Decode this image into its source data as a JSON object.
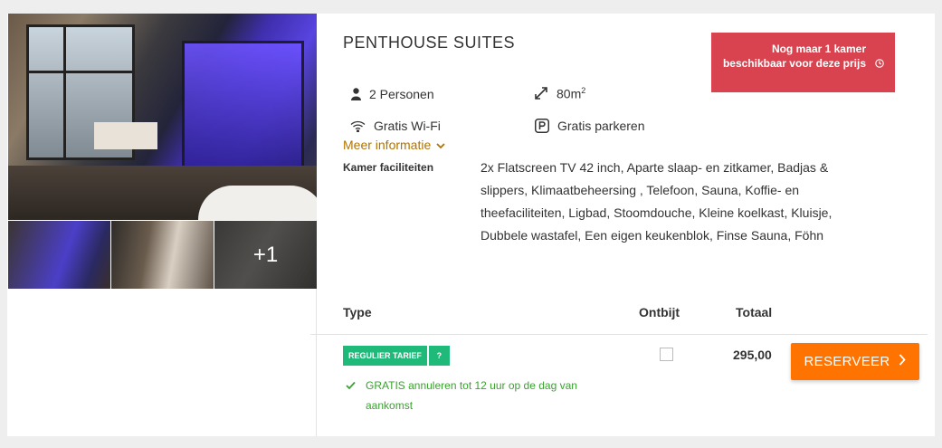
{
  "room": {
    "title": "PENTHOUSE SUITES",
    "photos_more": "+1",
    "features": {
      "persons": "2 Personen",
      "size": "80m",
      "size_sup": "2",
      "wifi": "Gratis Wi-Fi",
      "parking": "Gratis parkeren"
    },
    "more_info": "Meer informatie",
    "facilities_label": "Kamer faciliteiten",
    "facilities_text": "2x Flatscreen TV 42 inch, Aparte slaap- en zitkamer, Badjas & slippers, Klimaatbeheersing , Telefoon, Sauna, Koffie- en theefaciliteiten, Ligbad, Stoomdouche, Kleine koelkast, Kluisje, Dubbele wastafel, Een eigen keukenblok, Finse Sauna, Föhn"
  },
  "alert": {
    "text": "Nog maar 1 kamer beschikbaar voor deze prijs",
    "color": "#d9434f"
  },
  "table": {
    "headers": {
      "type": "Type",
      "breakfast": "Ontbijt",
      "total": "Totaal"
    },
    "rate": {
      "tag": "REGULIER TARIEF",
      "help": "?",
      "cancellation": "GRATIS annuleren tot 12 uur op de dag van aankomst",
      "breakfast_checked": false,
      "price": "295,00"
    }
  },
  "actions": {
    "reserve": "RESERVEER"
  },
  "colors": {
    "accent": "#ff7300",
    "tag": "#1fba7a",
    "link": "#b07300",
    "success": "#3aa22f"
  },
  "icons": [
    "user-icon",
    "expand-icon",
    "wifi-icon",
    "parking-icon",
    "chevron-down-icon",
    "clock-icon",
    "check-icon",
    "chevron-right-icon"
  ]
}
